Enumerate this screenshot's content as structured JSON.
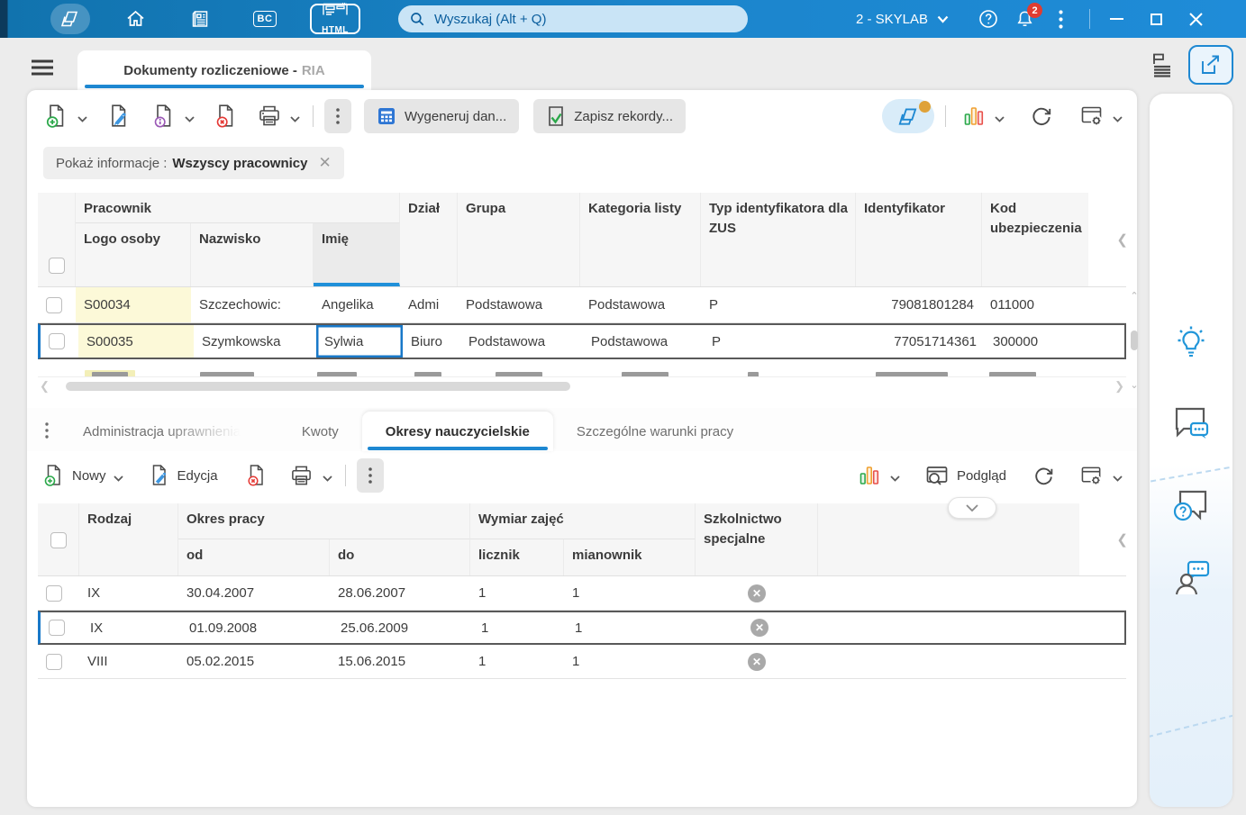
{
  "topbar": {
    "search_placeholder": "Wyszukaj (Alt + Q)",
    "profile_label": "2 - SKYLAB",
    "notification_count": "2",
    "bc_label": "BC",
    "html_label": "HTML"
  },
  "tab_strip": {
    "document_tab": "Dokumenty rozliczeniowe -",
    "document_tab_code": "RIA"
  },
  "main_toolbar": {
    "generate_button": "Wygeneruj dan...",
    "save_button": "Zapisz rekordy..."
  },
  "filter_chip": {
    "label": "Pokaż informacje :",
    "value": "Wszyscy pracownicy"
  },
  "employees_table": {
    "group_pracownik": "Pracownik",
    "col_logo": "Logo osoby",
    "col_nazwisko": "Nazwisko",
    "col_imie": "Imię",
    "col_dzial": "Dział",
    "col_grupa": "Grupa",
    "col_kategoria": "Kategoria listy",
    "col_typ_id": "Typ identyfikatora dla ZUS",
    "col_identyfikator": "Identyfikator",
    "col_kod": "Kod ubezpieczenia",
    "rows": [
      {
        "logo": "S00034",
        "nazwisko": "Szczechowic:",
        "imie": "Angelika",
        "dzial": "Admi",
        "grupa": "Podstawowa",
        "kategoria": "Podstawowa",
        "typ_id": "P",
        "identyfikator": "79081801284",
        "kod": "011000"
      },
      {
        "logo": "S00035",
        "nazwisko": "Szymkowska",
        "imie": "Sylwia",
        "dzial": "Biuro",
        "grupa": "Podstawowa",
        "kategoria": "Podstawowa",
        "typ_id": "P",
        "identyfikator": "77051714361",
        "kod": "300000"
      }
    ]
  },
  "detail_tabs": {
    "tab1": "Administracja uprawnieniami",
    "tab2": "Kwoty",
    "tab3": "Okresy nauczycielskie",
    "tab4": "Szczególne warunki pracy"
  },
  "detail_toolbar": {
    "new_button": "Nowy",
    "edit_button": "Edycja",
    "preview_button": "Podgląd"
  },
  "periods_table": {
    "col_rodzaj": "Rodzaj",
    "group_okres": "Okres pracy",
    "col_od": "od",
    "col_do": "do",
    "group_wymiar": "Wymiar zajęć",
    "col_licznik": "licznik",
    "col_mianownik": "mianownik",
    "col_szkolnictwo": "Szkolnictwo specjalne",
    "rows": [
      {
        "rodzaj": "IX",
        "od": "30.04.2007",
        "do": "28.06.2007",
        "licznik": "1",
        "mianownik": "1"
      },
      {
        "rodzaj": "IX",
        "od": "01.09.2008",
        "do": "25.06.2009",
        "licznik": "1",
        "mianownik": "1"
      },
      {
        "rodzaj": "VIII",
        "od": "05.02.2015",
        "do": "15.06.2015",
        "licznik": "1",
        "mianownik": "1"
      }
    ]
  },
  "colors": {
    "accent_blue": "#1e88d2",
    "highlight_yellow": "#fcf9d8",
    "badge_red": "#e03c31"
  }
}
